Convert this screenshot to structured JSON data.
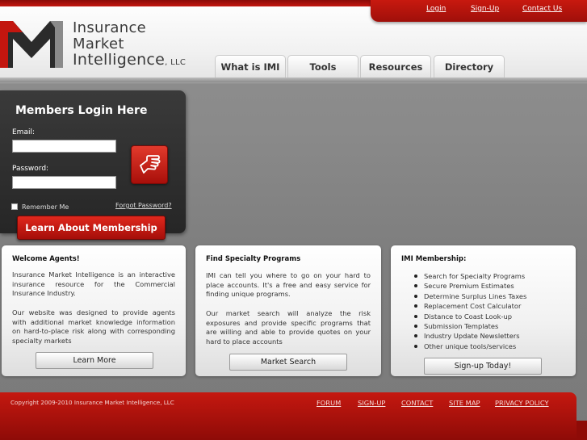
{
  "top_links": {
    "login": "Login",
    "signup": "Sign-Up",
    "contact": "Contact Us"
  },
  "logo": {
    "line1": "Insurance",
    "line2": "Market",
    "line3": "Intelligence",
    "suffix": ", LLC"
  },
  "nav": {
    "tabs": [
      "What is IMI",
      "Tools",
      "Resources",
      "Directory"
    ]
  },
  "login": {
    "title": "Members Login Here",
    "email_label": "Email:",
    "email_value": "",
    "password_label": "Password:",
    "password_value": "",
    "remember_label": "Remember Me",
    "forgot_label": "Forgot Password?",
    "membership_button": "Learn About Membership"
  },
  "boxes": {
    "welcome": {
      "title": "Welcome Agents!",
      "p1": "Insurance Market Intelligence is an interactive insurance resource for the Commercial Insurance Industry.",
      "p2": "Our website was designed to provide agents with additional market knowledge information on hard-to-place risk along with corresponding specialty markets",
      "button": "Learn More"
    },
    "find": {
      "title": "Find Specialty Programs",
      "p1": "IMI can tell you where to go on your hard to place accounts. It's a free and easy service for finding unique programs.",
      "p2": "Our market search will analyze the risk exposures and provide specific programs that are willing and able to provide quotes on your hard to place accounts",
      "button": "Market Search"
    },
    "membership": {
      "title": "IMI Membership:",
      "items": [
        "Search for Specialty Programs",
        "Secure Premium Estimates",
        "Determine Surplus Lines Taxes",
        "Replacement Cost Calculator",
        "Distance to Coast Look-up",
        "Submission Templates",
        "Industry Update Newsletters",
        "Other unique tools/services"
      ],
      "button": "Sign-up Today!"
    }
  },
  "footer": {
    "copyright": "Copyright 2009-2010 Insurance Market Intelligence, LLC",
    "links": [
      "FORUM",
      "SIGN-UP",
      "CONTACT",
      "SITE MAP",
      "PRIVACY POLICY"
    ]
  },
  "colors": {
    "brand_red": "#c4160f",
    "dark_red": "#8e0b07",
    "panel_dark": "#2e2e2e"
  }
}
